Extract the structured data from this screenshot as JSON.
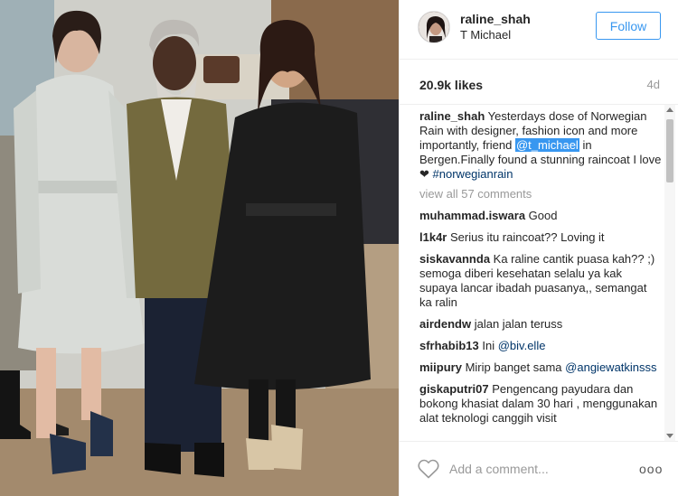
{
  "post": {
    "username": "raline_shah",
    "location": "T Michael",
    "follow_label": "Follow",
    "likes": "20.9k likes",
    "age": "4d"
  },
  "caption": {
    "username": "raline_shah",
    "text_before": "Yesterdays dose of Norwegian Rain with designer, fashion icon and more importantly, friend",
    "mention": "@t_michael",
    "text_after": "in Bergen.Finally found a stunning raincoat I love❤",
    "hashtag": "#norwegianrain"
  },
  "view_all": "view all 57 comments",
  "comments": [
    {
      "user": "muhammad.iswara",
      "text": "Good"
    },
    {
      "user": "l1k4r",
      "text": "Serius itu raincoat?? Loving it"
    },
    {
      "user": "siskavannda",
      "text": "Ka raline cantik puasa kah?? ;) semoga diberi kesehatan selalu ya kak supaya lancar ibadah puasanya,, semangat ka ralin"
    },
    {
      "user": "airdendw",
      "text": "jalan jalan teruss"
    },
    {
      "user": "sfrhabib13",
      "text": "Ini",
      "mention": "@biv.elle"
    },
    {
      "user": "miipury",
      "text": "Mirip banget sama",
      "mention": "@angiewatkinsss"
    },
    {
      "user": "giskaputri07",
      "text": "Pengencang payudara dan bokong khasiat dalam 30 hari , menggunakan alat teknologi canggih visit"
    }
  ],
  "add_comment": {
    "placeholder": "Add a comment..."
  },
  "more_label": "ooo",
  "icons": {
    "like": "heart-icon",
    "more": "more-options-icon",
    "avatar": "avatar"
  },
  "colors": {
    "accent": "#3897f0",
    "muted": "#999999",
    "text": "#262626",
    "hashtag": "#003569"
  }
}
